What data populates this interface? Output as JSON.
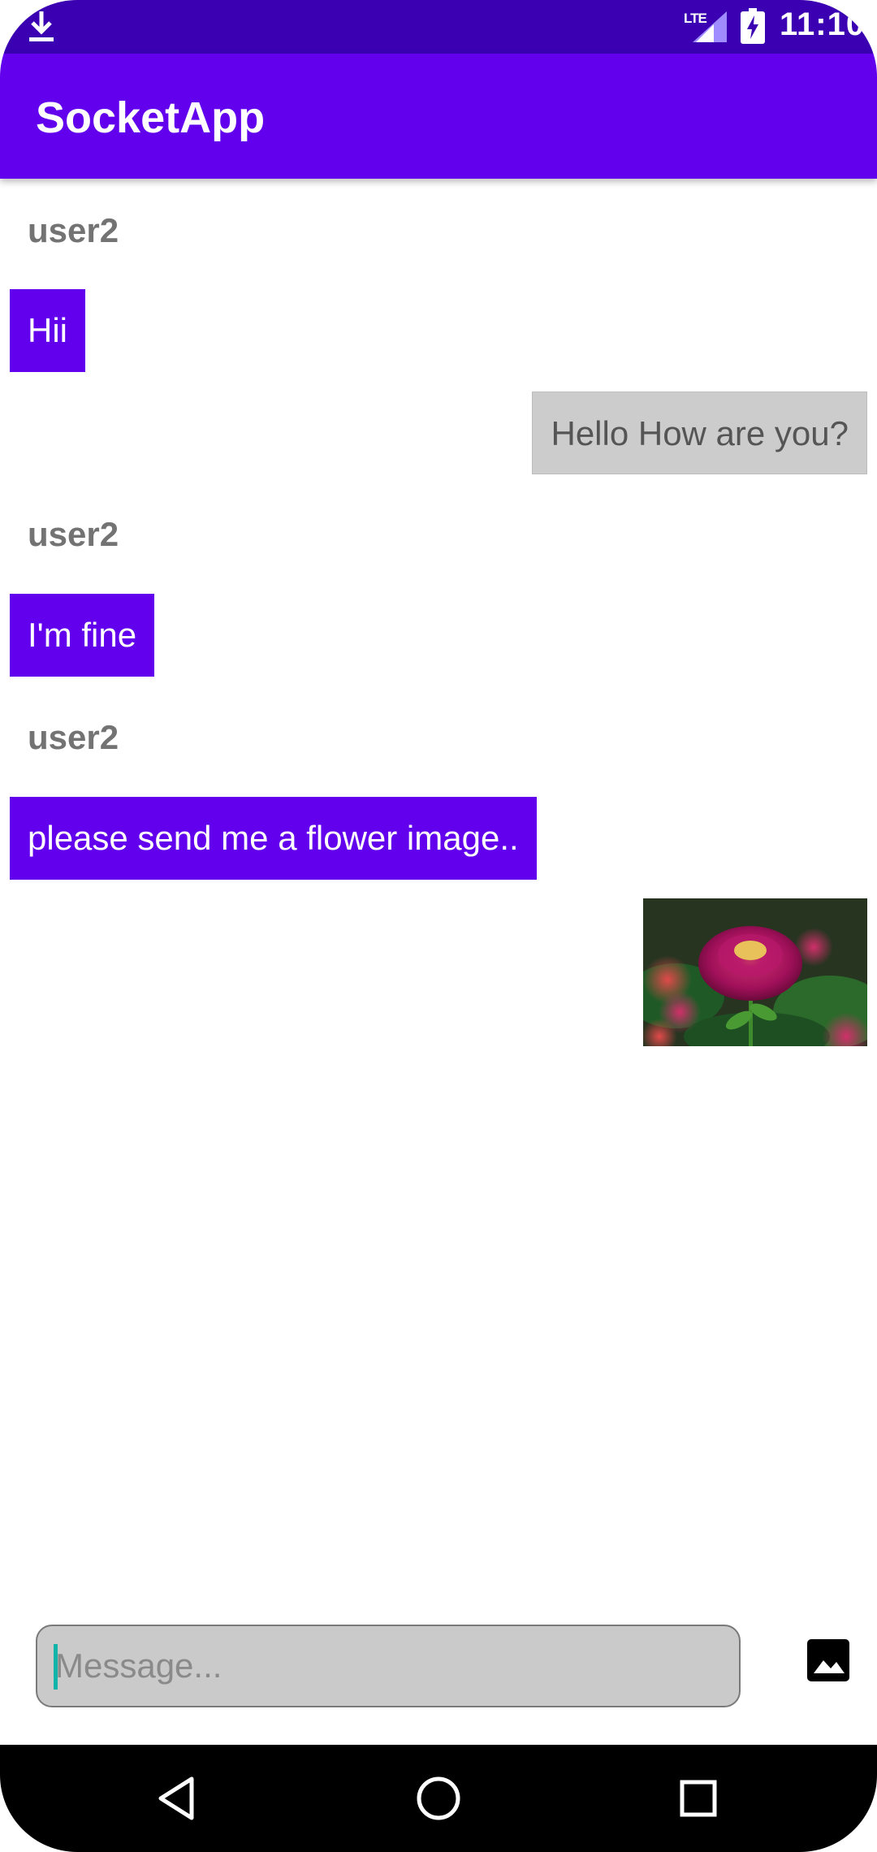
{
  "status_bar": {
    "time": "11:10",
    "network": "LTE",
    "icons": [
      "download-icon",
      "signal-icon",
      "battery-charging-icon"
    ]
  },
  "app_bar": {
    "title": "SocketApp"
  },
  "messages": [
    {
      "sender": "user2",
      "text": "Hii"
    },
    {
      "text": "Hello How are you?"
    },
    {
      "sender": "user2",
      "text": "I'm fine"
    },
    {
      "sender": "user2",
      "text": "please send me a flower image.."
    },
    {
      "image": "flower-photo"
    }
  ],
  "composer": {
    "placeholder": "Message...",
    "value": "",
    "attach_icon": "image-icon"
  },
  "navigation": {
    "icons": [
      "back-icon",
      "home-icon",
      "recents-icon"
    ]
  },
  "colors": {
    "primary": "#6200ee",
    "primary_dark": "#3700b3",
    "outgoing_bubble": "#cccccc",
    "sender_name": "#737373"
  }
}
